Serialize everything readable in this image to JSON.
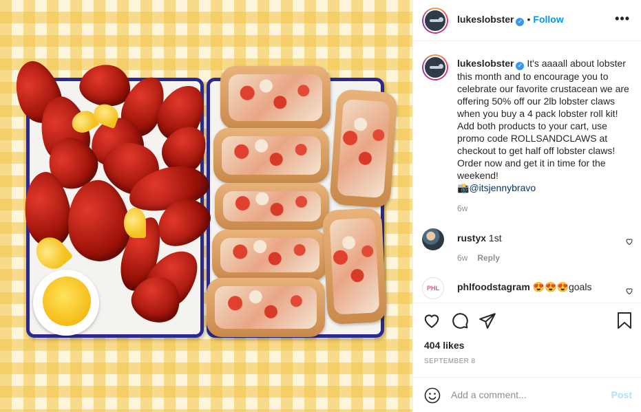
{
  "post": {
    "username": "lukeslobster",
    "verified_icon": "verified-badge-icon",
    "separator": "•",
    "follow_label": "Follow",
    "more_icon": "more-options-icon",
    "more_glyph": "•••"
  },
  "caption": {
    "username": "lukeslobster",
    "text": " It's aaaall about lobster this month and to encourage you to celebrate our favorite crustacean we are offering 50% off our 2lb lobster claws when you buy a 4 pack lobster roll kit! Add both products to your cart, use promo code ROLLSANDCLAWS at checkout to get half off lobster claws! Order now and get it in time for the weekend!",
    "camera_emoji": "📸",
    "photo_credit": "@itsjennybravo",
    "time": "6w"
  },
  "comments": [
    {
      "username": "rustyx",
      "text": "1st",
      "time": "6w",
      "reply_label": "Reply"
    },
    {
      "username": "phlfoodstagram",
      "emoji": "😍😍😍",
      "text": "goals",
      "avatar_text": "PHL"
    }
  ],
  "actions": {
    "likes": "404 likes",
    "date": "SEPTEMBER 8",
    "icons": [
      "heart-icon",
      "comment-icon",
      "share-icon",
      "bookmark-icon"
    ]
  },
  "add_comment": {
    "placeholder": "Add a comment...",
    "post_label": "Post",
    "emoji_icon": "smiley-icon"
  },
  "colors": {
    "accent": "#0095f6",
    "mention": "#00376b",
    "muted": "#8e8e8e",
    "post_disabled": "#b2dffc"
  }
}
